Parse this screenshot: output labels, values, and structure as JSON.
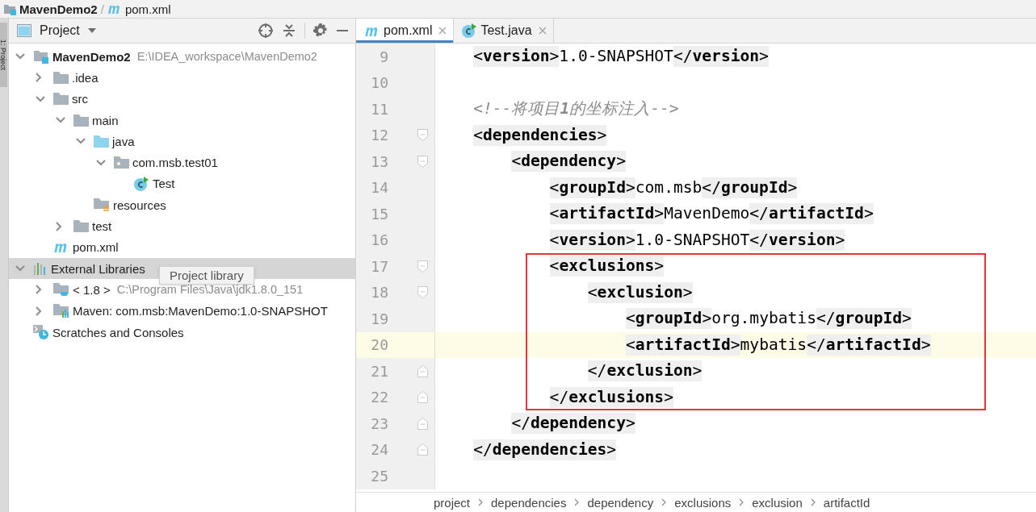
{
  "nav_bar": {
    "project": "MavenDemo2",
    "separator": "/",
    "file": "pom.xml"
  },
  "tool_stripe": {
    "label": "1: Project"
  },
  "project_panel": {
    "title": "Project",
    "tree": [
      {
        "label": "MavenDemo2",
        "path": "E:\\IDEA_workspace\\MavenDemo2",
        "kind": "module",
        "expanded": true,
        "selected": false,
        "children": [
          {
            "label": ".idea",
            "kind": "folder",
            "expanded": false,
            "selected": false
          },
          {
            "label": "src",
            "kind": "folder",
            "expanded": true,
            "selected": false,
            "children": [
              {
                "label": "main",
                "kind": "folder",
                "expanded": true,
                "selected": false,
                "children": [
                  {
                    "label": "java",
                    "kind": "source",
                    "expanded": true,
                    "selected": false,
                    "children": [
                      {
                        "label": "com.msb.test01",
                        "kind": "package",
                        "expanded": true,
                        "selected": false,
                        "children": [
                          {
                            "label": "Test",
                            "kind": "class",
                            "selected": false
                          }
                        ]
                      }
                    ]
                  },
                  {
                    "label": "resources",
                    "kind": "resources",
                    "selected": false
                  }
                ]
              },
              {
                "label": "test",
                "kind": "folder",
                "expanded": false,
                "selected": false
              }
            ]
          },
          {
            "label": "pom.xml",
            "kind": "maven",
            "selected": false
          }
        ]
      },
      {
        "label": "External Libraries",
        "kind": "libraries",
        "expanded": true,
        "selected": true,
        "children": [
          {
            "label": "< 1.8 >",
            "path": "C:\\Program Files\\Java\\jdk1.8.0_151",
            "kind": "jdk",
            "expanded": false,
            "selected": false
          },
          {
            "label": "Maven: com.msb:MavenDemo:1.0-SNAPSHOT",
            "kind": "lib",
            "expanded": false,
            "selected": false
          }
        ]
      },
      {
        "label": "Scratches and Consoles",
        "kind": "scratches",
        "selected": false
      }
    ],
    "tooltip": "Project library"
  },
  "tabs": [
    {
      "label": "pom.xml",
      "kind": "maven",
      "selected": true
    },
    {
      "label": "Test.java",
      "kind": "class",
      "selected": false
    }
  ],
  "code_lines": [
    {
      "number": "9",
      "caret": false,
      "boxed": false,
      "tokens": [
        {
          "kind": "tag",
          "text": "<**version**>"
        },
        {
          "kind": "text",
          "text": "1.0-SNAPSHOT"
        },
        {
          "kind": "tag",
          "text": "</**version**>"
        }
      ]
    },
    {
      "number": "10",
      "caret": false,
      "boxed": false
    },
    {
      "number": "11",
      "caret": false,
      "boxed": false,
      "tokens": [
        {
          "kind": "comment",
          "text": "<!--将项目**1**的坐标注入-->"
        }
      ]
    },
    {
      "number": "12",
      "kind": "fold-start",
      "caret": false,
      "boxed": false,
      "tokens": [
        {
          "kind": "tag",
          "text": "<**dependencies**>"
        }
      ],
      "children": [
        {
          "number": "13",
          "kind": "fold-start",
          "caret": false,
          "boxed": false,
          "tokens": [
            {
              "kind": "tag",
              "text": "<**dependency**>"
            }
          ],
          "children": [
            {
              "number": "14",
              "caret": false,
              "boxed": false,
              "tokens": [
                {
                  "kind": "tag",
                  "text": "<**groupId**>"
                },
                {
                  "kind": "text",
                  "text": "com.msb"
                },
                {
                  "kind": "tag",
                  "text": "</**groupId**>"
                }
              ]
            },
            {
              "number": "15",
              "caret": false,
              "boxed": false,
              "tokens": [
                {
                  "kind": "tag",
                  "text": "<**artifactId**>"
                },
                {
                  "kind": "text",
                  "text": "MavenDemo"
                },
                {
                  "kind": "tag",
                  "text": "</**artifactId**>"
                }
              ]
            },
            {
              "number": "16",
              "caret": false,
              "boxed": false,
              "tokens": [
                {
                  "kind": "tag",
                  "text": "<**version**>"
                },
                {
                  "kind": "text",
                  "text": "1.0-SNAPSHOT"
                },
                {
                  "kind": "tag",
                  "text": "</**version**>"
                }
              ]
            },
            {
              "number": "17",
              "kind": "fold-start",
              "caret": false,
              "boxed": true,
              "tokens": [
                {
                  "kind": "tag",
                  "text": "<**exclusions**>"
                }
              ],
              "children": [
                {
                  "number": "18",
                  "kind": "fold-start",
                  "caret": false,
                  "boxed": true,
                  "tokens": [
                    {
                      "kind": "tag",
                      "text": "<**exclusion**>"
                    }
                  ],
                  "children": [
                    {
                      "number": "19",
                      "caret": false,
                      "boxed": true,
                      "tokens": [
                        {
                          "kind": "tag",
                          "text": "<**groupId**>"
                        },
                        {
                          "kind": "text",
                          "text": "org.mybatis"
                        },
                        {
                          "kind": "tag",
                          "text": "</**groupId**>"
                        }
                      ]
                    },
                    {
                      "number": "20",
                      "caret": true,
                      "boxed": true,
                      "tokens": [
                        {
                          "kind": "tag",
                          "text": "<**artifactId**>"
                        },
                        {
                          "kind": "text",
                          "text": "mybatis"
                        },
                        {
                          "kind": "tag",
                          "text": "</**artifactId**>"
                        }
                      ]
                    }
                  ]
                },
                {
                  "number": "21",
                  "kind": "fold-end",
                  "caret": false,
                  "boxed": true,
                  "tokens": [
                    {
                      "kind": "tag",
                      "text": "</**exclusion**>"
                    }
                  ]
                }
              ]
            },
            {
              "number": "22",
              "kind": "fold-end",
              "caret": false,
              "boxed": true,
              "tokens": [
                {
                  "kind": "tag",
                  "text": "</**exclusions**>"
                }
              ]
            }
          ]
        },
        {
          "number": "23",
          "kind": "fold-end",
          "caret": false,
          "boxed": false,
          "tokens": [
            {
              "kind": "tag",
              "text": "</**dependency**>"
            }
          ]
        }
      ]
    },
    {
      "number": "24",
      "kind": "fold-end",
      "caret": false,
      "boxed": false,
      "tokens": [
        {
          "kind": "tag",
          "text": "</**dependencies**>"
        }
      ]
    },
    {
      "number": "25",
      "caret": false,
      "boxed": false
    }
  ],
  "breadcrumbs": [
    "project",
    "dependencies",
    "dependency",
    "exclusions",
    "exclusion",
    "artifactId"
  ]
}
